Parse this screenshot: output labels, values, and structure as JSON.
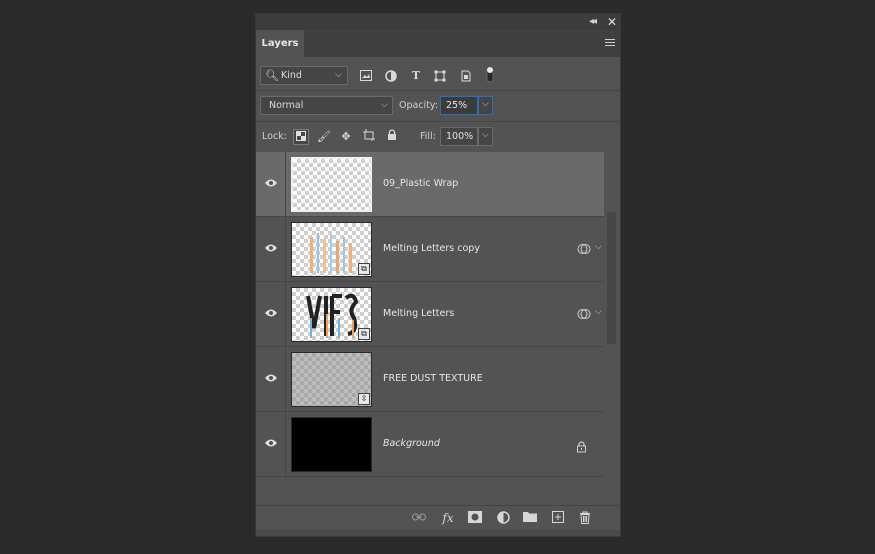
{
  "panel": {
    "tab_label": "Layers"
  },
  "filter": {
    "kind_label": "Kind",
    "icons": [
      "image-filter-icon",
      "adjustment-filter-icon",
      "type-filter-icon",
      "shape-filter-icon",
      "smart-object-filter-icon",
      "filter-toggle-icon"
    ]
  },
  "blend": {
    "mode": "Normal",
    "opacity_label": "Opacity:",
    "opacity_value": "25%"
  },
  "lock": {
    "label": "Lock:",
    "fill_label": "Fill:",
    "fill_value": "100%"
  },
  "layers": [
    {
      "name": "09_Plastic Wrap",
      "selected": true
    },
    {
      "name": "Melting Letters copy"
    },
    {
      "name": "Melting Letters"
    },
    {
      "name": "FREE DUST TEXTURE"
    },
    {
      "name": "Background"
    }
  ],
  "bottom_icons": [
    "link-layers-icon",
    "fx-icon",
    "add-mask-icon",
    "new-adjustment-icon",
    "new-group-icon",
    "new-layer-icon",
    "delete-icon"
  ],
  "colors": {
    "panel_bg": "#535353",
    "selected_row": "#6a6a6a",
    "focus_border": "#2f6db5"
  }
}
